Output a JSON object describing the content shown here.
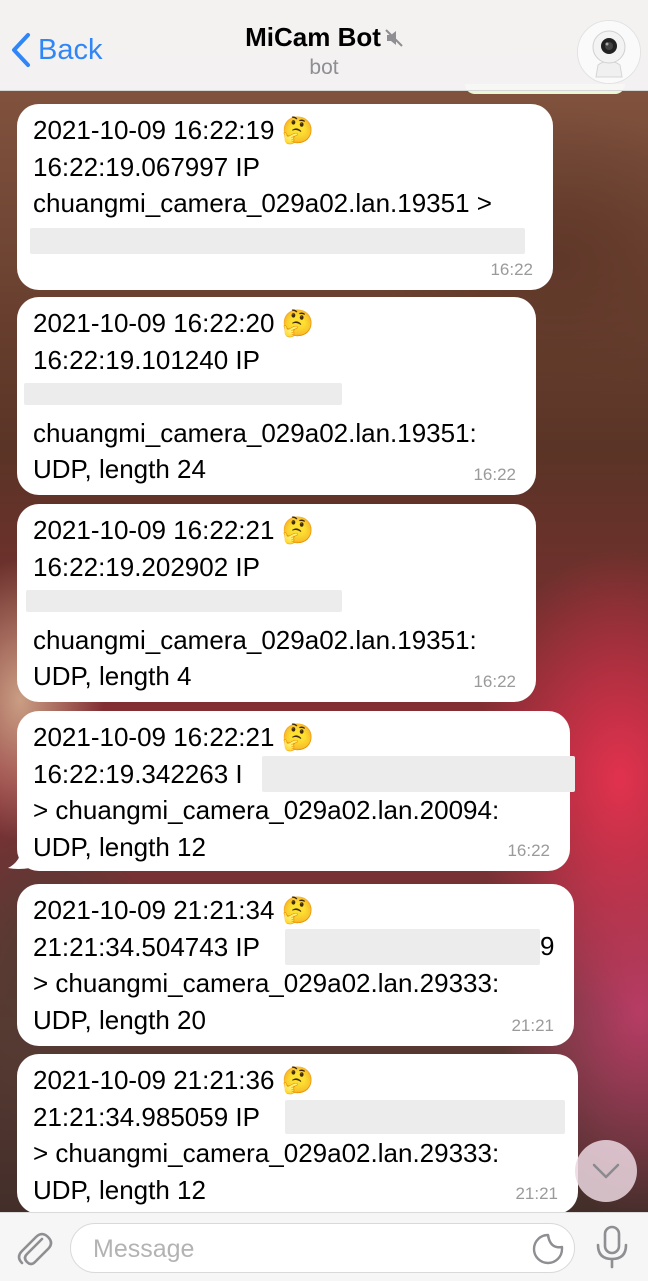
{
  "header": {
    "back_label": "Back",
    "title": "MiCam Bot",
    "subtitle": "bot",
    "mute_icon": "muted-speaker-icon",
    "avatar_icon": "security-camera-icon"
  },
  "messages": [
    {
      "lines": [
        "2021-10-09 16:22:19",
        "16:22:19.067997 IP",
        "chuangmi_camera_029a02.lan.19351 >",
        ""
      ],
      "time": "16:22"
    },
    {
      "lines": [
        "2021-10-09 16:22:20",
        "16:22:19.101240 IP",
        "",
        "chuangmi_camera_029a02.lan.19351:",
        "UDP, length 24"
      ],
      "time": "16:22"
    },
    {
      "lines": [
        "2021-10-09 16:22:21",
        "16:22:19.202902 IP",
        "",
        "chuangmi_camera_029a02.lan.19351:",
        "UDP, length 4"
      ],
      "time": "16:22"
    },
    {
      "lines": [
        "2021-10-09 16:22:21",
        "16:22:19.342263 I",
        "> chuangmi_camera_029a02.lan.20094:",
        "UDP, length 12"
      ],
      "time": "16:22"
    },
    {
      "lines": [
        "2021-10-09 21:21:34",
        "21:21:34.504743 IP",
        "> chuangmi_camera_029a02.lan.29333:",
        "UDP, length 20"
      ],
      "time": "21:21",
      "trail": "9"
    },
    {
      "lines": [
        "2021-10-09 21:21:36",
        "21:21:34.985059 IP",
        "> chuangmi_camera_029a02.lan.29333:",
        "UDP, length 12"
      ],
      "time": "21:21"
    }
  ],
  "emoji": "🤔",
  "input": {
    "placeholder": "Message",
    "value": ""
  },
  "colors": {
    "accent": "#2f86f6",
    "bubble": "#ffffff",
    "timestamp": "#9a9a9a"
  }
}
